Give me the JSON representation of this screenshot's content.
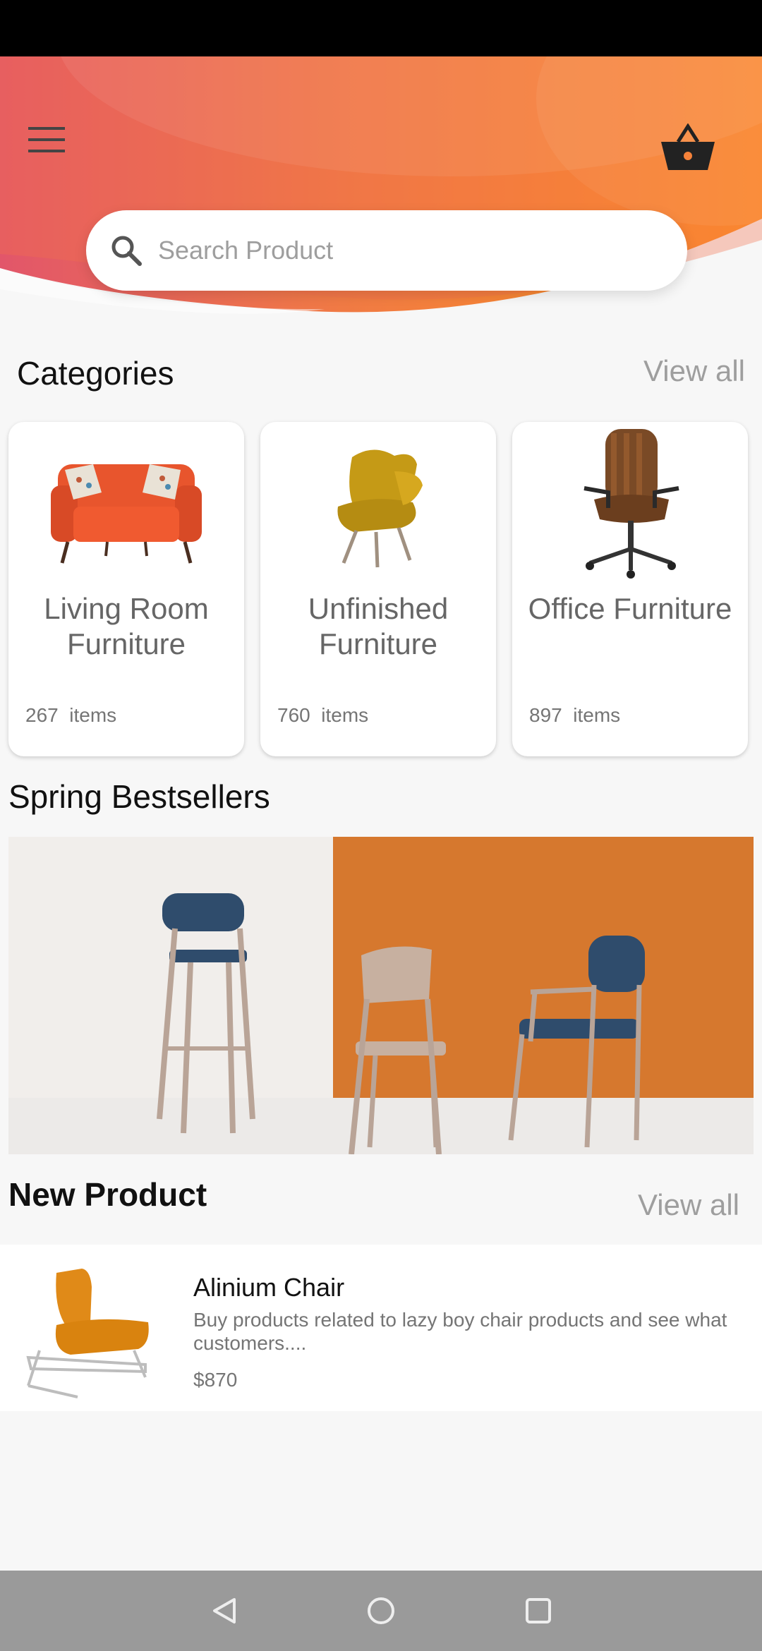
{
  "search": {
    "placeholder": "Search Product"
  },
  "header": {
    "menu_icon": "hamburger-menu-icon",
    "cart_icon": "shopping-basket-icon"
  },
  "categories": {
    "title": "Categories",
    "view_all": "View all",
    "items": [
      {
        "name": "Living Room Furniture",
        "count": "267",
        "unit": "items",
        "icon": "sofa-image"
      },
      {
        "name": "Unfinished Furniture",
        "count": "760",
        "unit": "items",
        "icon": "lounge-chair-image"
      },
      {
        "name": "Office Furniture",
        "count": "897",
        "unit": "items",
        "icon": "office-chair-image"
      }
    ]
  },
  "bestsellers": {
    "title": "Spring Bestsellers"
  },
  "new_product": {
    "title": "New Product",
    "view_all": "View all",
    "items": [
      {
        "name": "Alinium Chair",
        "description": "Buy products related to lazy boy chair products and see what customers....",
        "price": "$870"
      }
    ]
  },
  "colors": {
    "accent_orange": "#f5823a",
    "accent_red": "#e85a64",
    "text_gray": "#757575"
  },
  "nav": {
    "back_icon": "back-icon",
    "home_icon": "home-icon",
    "recents_icon": "recents-icon"
  }
}
